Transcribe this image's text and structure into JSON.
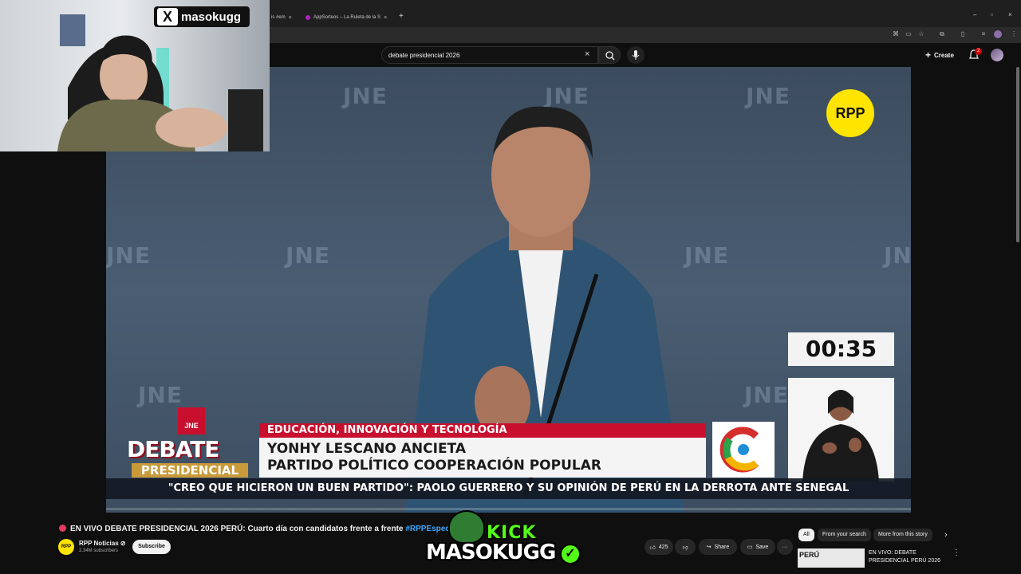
{
  "browser": {
    "tabs": [
      {
        "label": "is #em",
        "close": "×"
      },
      {
        "label": "AppSorteos – La Ruleta de la S",
        "close": "×"
      }
    ],
    "new_tab": "+",
    "window_controls": [
      "–",
      "▫",
      "×"
    ]
  },
  "youtube_header": {
    "search_value": "debate presidencial 2026",
    "create_label": "Create",
    "notification_count": "2"
  },
  "webcam": {
    "streamer_name": "masokugg",
    "platform_icon": "x-logo-icon"
  },
  "video": {
    "background_text": "JNE",
    "broadcaster": "RPP",
    "timer": "00:35",
    "lower_third_topic": "EDUCACIÓN, INNOVACIÓN Y TECNOLOGÍA",
    "lower_third_name": "YONHY LESCANO ANCIETA",
    "lower_third_party": "PARTIDO POLÍTICO COOPERACIÓN POPULAR",
    "debate_badge": "JNE",
    "debate_word": "DEBATE",
    "presidencial_word": "PRESIDENCIAL",
    "ticker": "\"CREO QUE HICIERON UN BUEN PARTIDO\": PAOLO GUERRERO Y SU OPINIÓN DE PERÚ EN LA DERROTA ANTE SENEGAL"
  },
  "watch": {
    "title_main": "EN VIVO DEBATE PRESIDENCIAL 2026 PERÚ: Cuarto día con candidatos frente a frente ",
    "title_tag": "#RPPEspeciales",
    "channel_avatar": "RPP",
    "channel_name": "RPP Noticias ⊘",
    "channel_subs": "2.34M subscribers",
    "subscribe_label": "Subscribe",
    "like_count": "425",
    "share_label": "Share",
    "save_label": "Save",
    "more_label": "···"
  },
  "related": {
    "chips": [
      "All",
      "From your search",
      "More from this story"
    ],
    "next_chip": "›",
    "rec_thumb_text": "PERÚ",
    "rec_title": "EN VIVO: DEBATE PRESIDENCIAL PERÚ 2026",
    "rec_more": "⋮"
  },
  "watermark": {
    "top": "KICK",
    "bottom": "MASOKUGG",
    "check": "✓"
  },
  "colors": {
    "youtube_bg": "#0f0f0f",
    "news_red": "#c8102e",
    "rpp_yellow": "#ffe400",
    "kick_green": "#53fc18",
    "link_blue": "#3ea6ff"
  }
}
